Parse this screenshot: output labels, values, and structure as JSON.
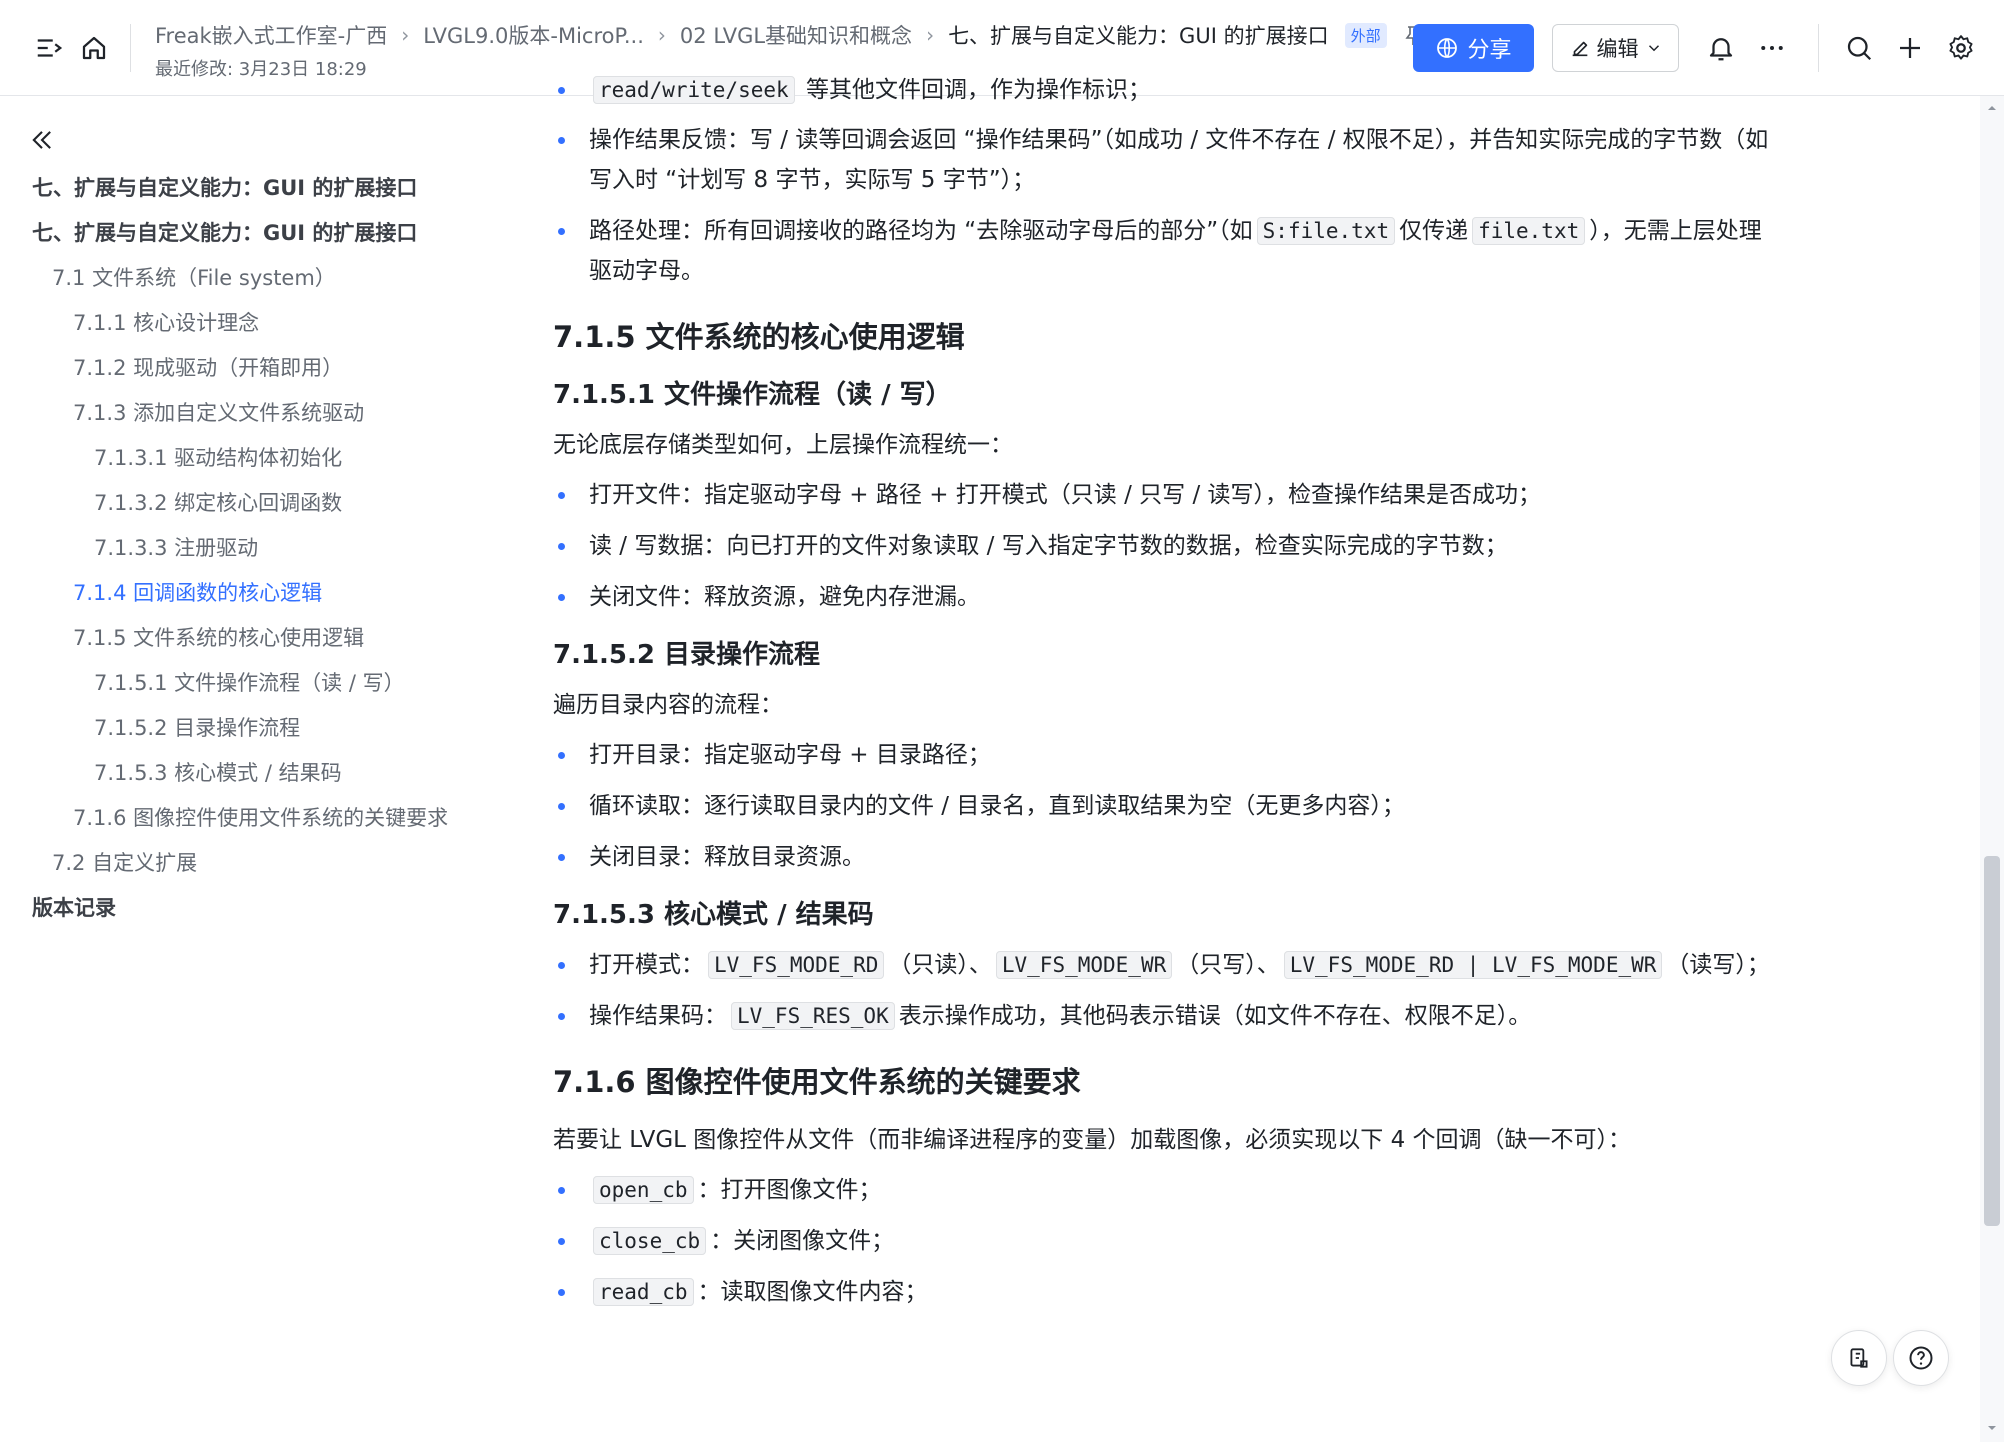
{
  "header": {
    "breadcrumbs": [
      "Freak嵌入式工作室-广西",
      "LVGL9.0版本-MicroP...",
      "02 LVGL基础知识和概念",
      "七、扩展与自定义能力：GUI 的扩展接口"
    ],
    "badge": "外部",
    "last_modified": "最近修改: 3月23日 18:29",
    "share_label": "分享",
    "edit_label": "编辑",
    "accent_color": "#3370ff"
  },
  "toc": [
    {
      "label": "七、扩展与自定义能力：GUI 的扩展接口",
      "level": 0
    },
    {
      "label": "七、扩展与自定义能力：GUI 的扩展接口",
      "level": 0
    },
    {
      "label": "7.1 文件系统（File system）",
      "level": 1
    },
    {
      "label": "7.1.1 核心设计理念",
      "level": 2
    },
    {
      "label": "7.1.2 现成驱动（开箱即用）",
      "level": 2
    },
    {
      "label": "7.1.3 添加自定义文件系统驱动",
      "level": 2
    },
    {
      "label": "7.1.3.1 驱动结构体初始化",
      "level": 3
    },
    {
      "label": "7.1.3.2 绑定核心回调函数",
      "level": 3
    },
    {
      "label": "7.1.3.3 注册驱动",
      "level": 3
    },
    {
      "label": "7.1.4 回调函数的核心逻辑",
      "level": 2,
      "active": true
    },
    {
      "label": "7.1.5 文件系统的核心使用逻辑",
      "level": 2
    },
    {
      "label": "7.1.5.1 文件操作流程（读 / 写）",
      "level": 3
    },
    {
      "label": "7.1.5.2 目录操作流程",
      "level": 3
    },
    {
      "label": "7.1.5.3 核心模式 / 结果码",
      "level": 3
    },
    {
      "label": "7.1.6 图像控件使用文件系统的关键要求",
      "level": 2
    },
    {
      "label": "7.2 自定义扩展",
      "level": 1
    },
    {
      "label": "版本记录",
      "level": 0
    }
  ],
  "content": {
    "top_line_code": "read/write/seek",
    "top_line_text": "等其他文件回调，作为操作标识；",
    "b1": "操作结果反馈：写 / 读等回调会返回 “操作结果码”（如成功 / 文件不存在 / 权限不足），并告知实际完成的字节数（如写入时 “计划写 8 字节，实际写 5 字节”）；",
    "b2_a": "路径处理：所有回调接收的路径均为 “去除驱动字母后的部分”（如",
    "b2_code1": "S:file.txt",
    "b2_b": "仅传递",
    "b2_code2": "file.txt",
    "b2_c": "），无需上层处理驱动字母。",
    "h_715": "7.1.5 文件系统的核心使用逻辑",
    "h_7151": "7.1.5.1 文件操作流程（读 / 写）",
    "p_7151": "无论底层存储类型如何，上层操作流程统一：",
    "l_7151": [
      "打开文件：指定驱动字母 + 路径 + 打开模式（只读 / 只写 / 读写），检查操作结果是否成功；",
      "读 / 写数据：向已打开的文件对象读取 / 写入指定字节数的数据，检查实际完成的字节数；",
      "关闭文件：释放资源，避免内存泄漏。"
    ],
    "h_7152": "7.1.5.2 目录操作流程",
    "p_7152": "遍历目录内容的流程：",
    "l_7152": [
      "打开目录：指定驱动字母 + 目录路径；",
      "循环读取：逐行读取目录内的文件 / 目录名，直到读取结果为空（无更多内容）；",
      "关闭目录：释放目录资源。"
    ],
    "h_7153": "7.1.5.3 核心模式 / 结果码",
    "m_label": "打开模式：",
    "m_code1": "LV_FS_MODE_RD",
    "m_t1": "（只读）、",
    "m_code2": "LV_FS_MODE_WR",
    "m_t2": "（只写）、",
    "m_code3": "LV_FS_MODE_RD | LV_FS_MODE_WR",
    "m_t3": "（读写）；",
    "r_label": "操作结果码：",
    "r_code": "LV_FS_RES_OK",
    "r_text": "表示操作成功，其他码表示错误（如文件不存在、权限不足）。",
    "h_716": "7.1.6 图像控件使用文件系统的关键要求",
    "p_716": "若要让 LVGL 图像控件从文件（而非编译进程序的变量）加载图像，必须实现以下 4 个回调（缺一不可）：",
    "cb": [
      {
        "code": "open_cb",
        "text": "：打开图像文件；"
      },
      {
        "code": "close_cb",
        "text": "：关闭图像文件；"
      },
      {
        "code": "read_cb",
        "text": "：读取图像文件内容；"
      }
    ]
  }
}
